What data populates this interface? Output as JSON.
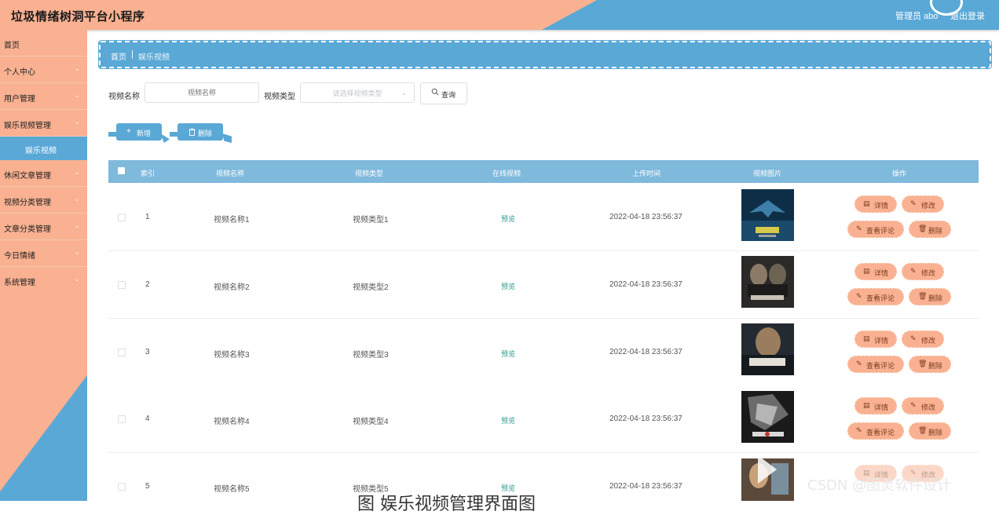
{
  "header": {
    "title": "垃圾情绪树洞平台小程序",
    "user": "管理员 abo",
    "logout": "退出登录"
  },
  "sidebar": {
    "items": [
      {
        "label": "首页",
        "chevron": ""
      },
      {
        "label": "个人中心",
        "chevron": "⌄"
      },
      {
        "label": "用户管理",
        "chevron": "⌄"
      },
      {
        "label": "娱乐视频管理",
        "chevron": "⌄"
      },
      {
        "label": "休闲文章管理",
        "chevron": "⌄"
      },
      {
        "label": "视频分类管理",
        "chevron": "⌄"
      },
      {
        "label": "文章分类管理",
        "chevron": "⌄"
      },
      {
        "label": "今日情绪",
        "chevron": "⌄"
      },
      {
        "label": "系统管理",
        "chevron": "⌄"
      }
    ],
    "active_sub": "娱乐视频"
  },
  "breadcrumb": {
    "home": "首页",
    "separator": "|",
    "current": "娱乐视频"
  },
  "search": {
    "name_label": "视频名称",
    "name_placeholder": "视频名称",
    "type_label": "视频类型",
    "type_placeholder": "请选择视频类型",
    "query_button": "查询"
  },
  "toolbar": {
    "add_label": "新增",
    "delete_label": "删除"
  },
  "table": {
    "headers": [
      "索引",
      "视频名称",
      "视频类型",
      "在线视频",
      "上传时间",
      "视频图片",
      "操作"
    ],
    "rows": [
      {
        "index": "1",
        "name": "视频名称1",
        "type": "视频类型1",
        "video": "预览",
        "time": "2022-04-18 23:56:37"
      },
      {
        "index": "2",
        "name": "视频名称2",
        "type": "视频类型2",
        "video": "预览",
        "time": "2022-04-18 23:56:37"
      },
      {
        "index": "3",
        "name": "视频名称3",
        "type": "视频类型3",
        "video": "预览",
        "time": "2022-04-18 23:56:37"
      },
      {
        "index": "4",
        "name": "视频名称4",
        "type": "视频类型4",
        "video": "预览",
        "time": "2022-04-18 23:56:37"
      },
      {
        "index": "5",
        "name": "视频名称5",
        "type": "视频类型5",
        "video": "预览",
        "time": "2022-04-18 23:56:37"
      }
    ],
    "actions": {
      "detail": "详情",
      "edit": "修改",
      "comments": "查看评论",
      "delete": "删除"
    }
  },
  "watermark": "CSDN @图灵软件设计",
  "caption": "图     娱乐视频管理界面图",
  "colors": {
    "peach": "#f9b191",
    "blue": "#5aa8d6",
    "table_header": "#7fb9dc",
    "preview_link": "#2e9b8f"
  }
}
